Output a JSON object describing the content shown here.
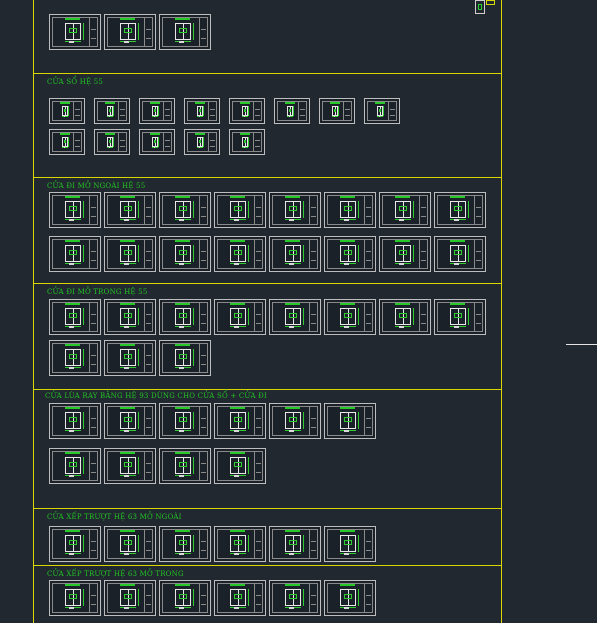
{
  "sections": [
    {
      "title": "",
      "rows": [
        3
      ]
    },
    {
      "title": "CỬA SỔ HỆ 55",
      "rows": [
        8,
        5
      ]
    },
    {
      "title": "CỬA ĐI MỞ NGOÀI HỆ 55",
      "rows": [
        8,
        8
      ]
    },
    {
      "title": "CỬA ĐI MỞ TRONG HỆ 55",
      "rows": [
        8,
        3
      ]
    },
    {
      "title": "CỬA LÙA RAY BẰNG HỆ 93 DÙNG CHO CỬA SỔ + CỬA ĐI",
      "rows": [
        6,
        4
      ]
    },
    {
      "title": "CỬA XẾP TRƯỢT HỆ 63 MỞ NGOÀI",
      "rows": [
        6
      ]
    },
    {
      "title": "CỬA XẾP TRƯỢT HỆ 63 MỞ TRONG",
      "rows": [
        6
      ]
    }
  ],
  "colors": {
    "background": "#212830",
    "frame": "#d8d800",
    "title": "#22c422",
    "sheet_border": "#bdbdbd"
  }
}
